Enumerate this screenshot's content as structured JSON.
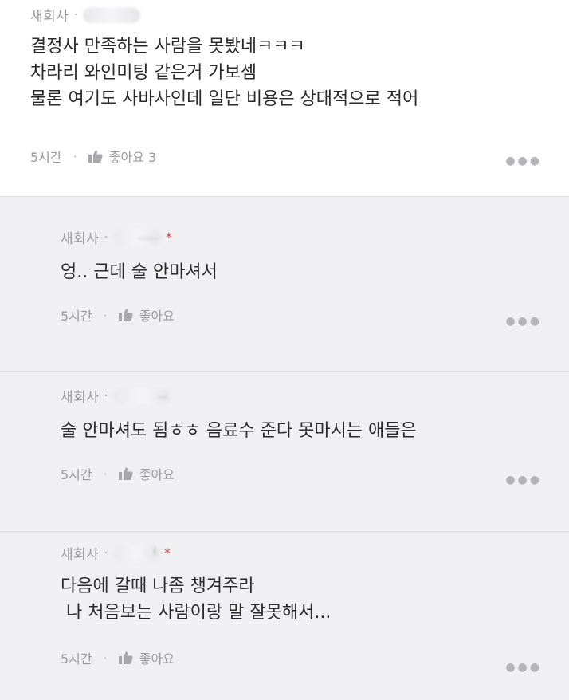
{
  "comment": {
    "company": "새회사",
    "body": "결정사 만족하는 사람을 못봤네ㅋㅋㅋ\n차라리 와인미팅 같은거 가보셈\n물론 여기도 사바사인데 일단 비용은 상대적으로 적어",
    "time": "5시간",
    "like_label": "좋아요 3"
  },
  "replies": [
    {
      "company": "새회사",
      "name_tail": "......",
      "star": "*",
      "body": "엉.. 근데 술 안마셔서",
      "time": "5시간",
      "like_label": "좋아요"
    },
    {
      "company": "새회사",
      "name_tail": "...",
      "star": "",
      "body": "술 안마셔도 됨ㅎㅎ 음료수 준다 못마시는 애들은",
      "time": "5시간",
      "like_label": "좋아요"
    },
    {
      "company": "새회사",
      "name_tail": "i",
      "star": "*",
      "body": "다음에 갈때 나좀 챙겨주라\n 나 처음보는 사람이랑 말 잘못해서...",
      "time": "5시간",
      "like_label": "좋아요"
    }
  ],
  "icons": {
    "like": "thumbs-up-icon",
    "more": "more-icon"
  },
  "colors": {
    "reply_background": "#f0f0f2",
    "star": "#d23b3b"
  }
}
